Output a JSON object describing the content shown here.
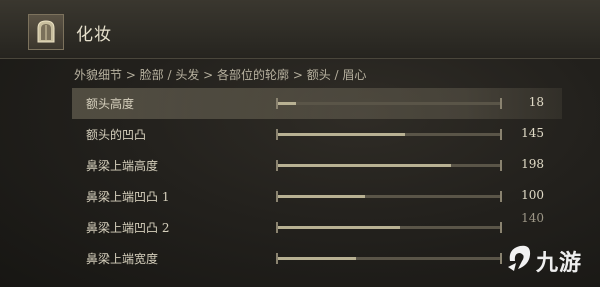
{
  "header": {
    "title": "化妆",
    "icon": "mirror-icon"
  },
  "breadcrumb": "外貌细节 > 脸部 / 头发 > 各部位的轮廓 > 额头 / 眉心",
  "rows": [
    {
      "label": "额头高度",
      "value": "18",
      "fraction": 0.08,
      "selected": true
    },
    {
      "label": "额头的凹凸",
      "value": "145",
      "fraction": 0.57
    },
    {
      "label": "鼻梁上端高度",
      "value": "198",
      "fraction": 0.78
    },
    {
      "label": "鼻梁上端凹凸 1",
      "value": "100",
      "fraction": 0.39
    },
    {
      "label": "鼻梁上端凹凸 2",
      "value": "140",
      "fraction": 0.55
    },
    {
      "label": "鼻梁上端宽度",
      "value": "",
      "fraction": 0.35
    }
  ],
  "watermark": {
    "logo": "jiuyou-logo",
    "text": "九游"
  }
}
